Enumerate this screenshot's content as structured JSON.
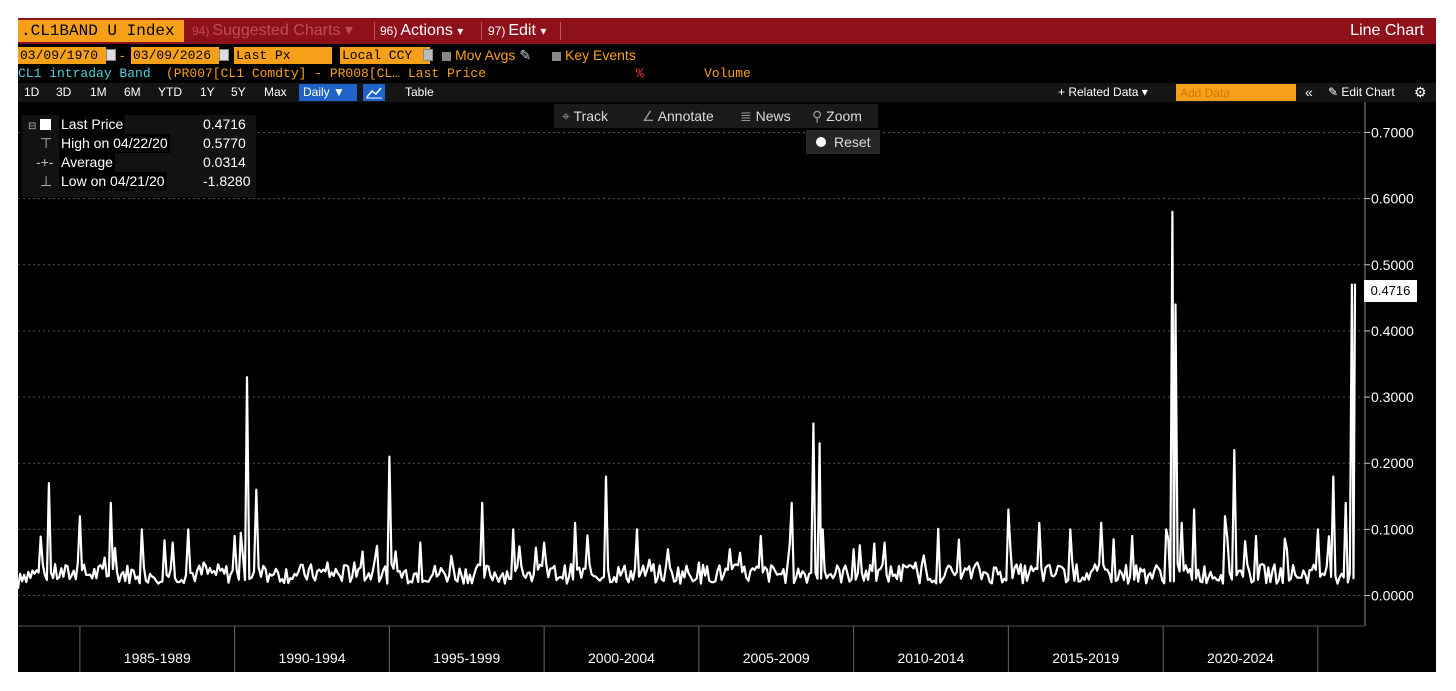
{
  "titlebar": {
    "ticker": ".CL1BAND U Index",
    "suggested": {
      "num": "94)",
      "label": "Suggested Charts",
      "arrow": "▾"
    },
    "actions": {
      "num": "96)",
      "label": "Actions",
      "arrow": "▾"
    },
    "edit": {
      "num": "97)",
      "label": "Edit",
      "arrow": "▾"
    },
    "chart_type": "Line Chart"
  },
  "range": {
    "start_date": "03/09/1970",
    "dash": "-",
    "end_date": "03/09/2026",
    "field": "Last Px",
    "currency": "Local CCY",
    "mov_avgs": "Mov Avgs",
    "key_events": "Key Events"
  },
  "series_row": {
    "name": "CL1 intraday Band",
    "formula": "(PR007[CL1 Comdty] - PR008[CL…",
    "field": "Last Price",
    "pct": "%",
    "volume": "Volume"
  },
  "periods": [
    "1D",
    "3D",
    "1M",
    "6M",
    "YTD",
    "1Y",
    "5Y",
    "Max"
  ],
  "toolbar": {
    "frequency": "Daily",
    "frequency_arrow": "▼",
    "table": "Table",
    "related_data": "+ Related Data",
    "related_arrow": "▾",
    "add_data_placeholder": "Add Data",
    "collapse": "«",
    "edit_chart": "Edit Chart",
    "settings_icon": "gear-icon"
  },
  "tools": {
    "track": "Track",
    "annotate": "Annotate",
    "news": "News",
    "zoom": "Zoom",
    "reset": "Reset"
  },
  "legend": [
    {
      "label": "Last Price",
      "value": "0.4716"
    },
    {
      "label": "High on 04/22/20",
      "value": "0.5770"
    },
    {
      "label": "Average",
      "value": "0.0314"
    },
    {
      "label": "Low on 04/21/20",
      "value": "-1.8280"
    }
  ],
  "last_badge": "0.4716",
  "colors": {
    "accent": "#f6a01a",
    "titlebar": "#8e101a",
    "series": "#ffffff",
    "cyan": "#4fd1e0",
    "blue": "#1f62c8"
  },
  "chart_data": {
    "type": "line",
    "series": [
      {
        "x": [
          "1983",
          "1984",
          "1985",
          "1986",
          "1987",
          "1988",
          "1988.5",
          "1989",
          "1990",
          "1990.4",
          "1990.7",
          "1991",
          "1992",
          "1993",
          "1994",
          "1995",
          "1996",
          "1997",
          "1998",
          "1999",
          "2000",
          "2001",
          "2002",
          "2003",
          "2004",
          "2005",
          "2006",
          "2007",
          "2008",
          "2008.7",
          "2008.9",
          "2009",
          "2010",
          "2011",
          "2012",
          "2013",
          "2014",
          "2015",
          "2016",
          "2017",
          "2018",
          "2019",
          "2020.1",
          "2020.3",
          "2020.4",
          "2020.6",
          "2021",
          "2022",
          "2022.3",
          "2023",
          "2024",
          "2025",
          "2025.5",
          "2025.9",
          "2026.1",
          "2026.2"
        ],
        "y": [
          0.01,
          0.17,
          0.12,
          0.14,
          0.1,
          0.08,
          0.1,
          0.05,
          0.09,
          0.33,
          0.16,
          0.04,
          0.03,
          0.05,
          0.04,
          0.21,
          0.08,
          0.06,
          0.14,
          0.1,
          0.08,
          0.11,
          0.18,
          0.1,
          0.07,
          0.05,
          0.07,
          0.09,
          0.14,
          0.26,
          0.23,
          0.1,
          0.07,
          0.08,
          0.05,
          0.04,
          0.05,
          0.13,
          0.11,
          0.1,
          0.11,
          0.09,
          0.1,
          0.58,
          0.44,
          0.11,
          0.13,
          0.12,
          0.22,
          0.09,
          0.07,
          0.1,
          0.18,
          0.14,
          0.47,
          0.4716
        ]
      }
    ],
    "x_ticks": [
      "1985-1989",
      "1990-1994",
      "1995-1999",
      "2000-2004",
      "2005-2009",
      "2010-2014",
      "2015-2019",
      "2020-2024"
    ],
    "y_ticks": [
      0.0,
      0.1,
      0.2,
      0.3,
      0.4,
      0.5,
      0.6,
      0.7
    ],
    "y_tick_labels": [
      "0.0000",
      "0.1000",
      "0.2000",
      "0.3000",
      "0.4000",
      "0.5000",
      "0.6000",
      "0.7000"
    ],
    "ylim": [
      -0.04,
      0.74
    ],
    "grid": true
  }
}
